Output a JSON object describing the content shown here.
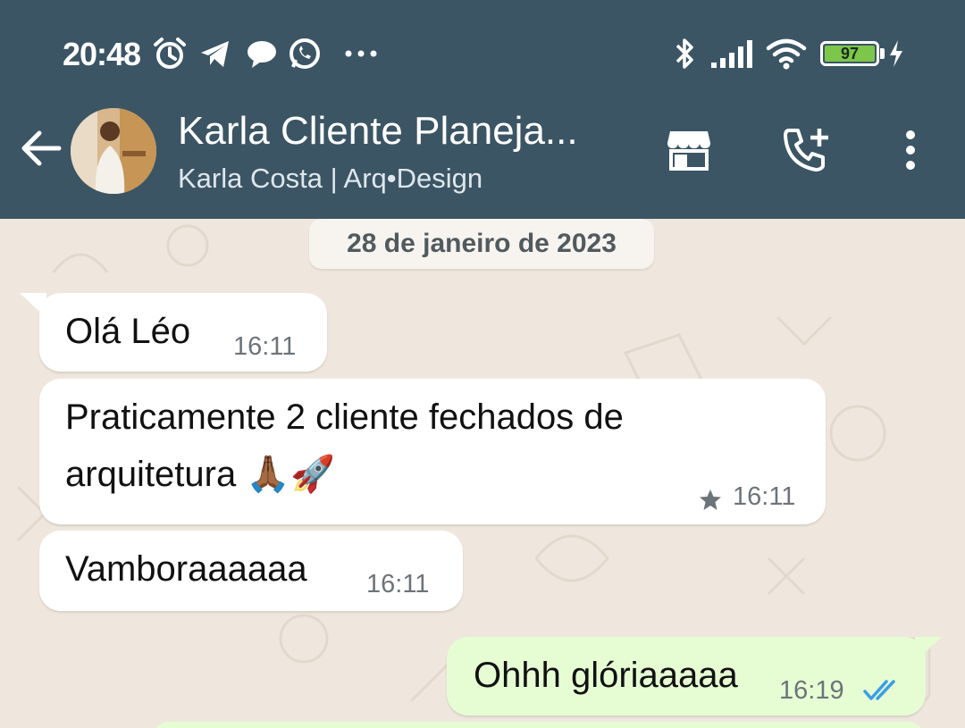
{
  "status_bar": {
    "time": "20:48",
    "battery_level": "97",
    "left_icons": [
      "alarm-icon",
      "telegram-icon",
      "chat-bubble-icon",
      "whatsapp-icon",
      "more-dots-icon"
    ],
    "right_icons": [
      "bluetooth-icon",
      "signal-icon",
      "wifi-icon",
      "battery-icon",
      "charging-icon"
    ]
  },
  "header": {
    "title": "Karla Cliente Planeja...",
    "subtitle": "Karla Costa | Arq•Design",
    "actions": [
      "store-icon",
      "add-call-icon",
      "overflow-menu-icon"
    ],
    "bar_color": "#3b5564"
  },
  "conversation": {
    "date_label": "28 de janeiro de 2023",
    "messages": [
      {
        "direction": "incoming",
        "text": "Olá Léo",
        "time": "16:11"
      },
      {
        "direction": "incoming",
        "text_line1": "Praticamente 2 cliente fechados de",
        "text_line2": "arquitetura",
        "emoji": "🙏🏾🚀",
        "time": "16:11",
        "starred": true
      },
      {
        "direction": "incoming",
        "text": "Vamboraaaaaa",
        "time": "16:11"
      },
      {
        "direction": "outgoing",
        "text": "Ohhh glóriaaaaa",
        "time": "16:19",
        "status": "read"
      }
    ],
    "incoming_color": "#ffffff",
    "outgoing_color": "#e6fdd4",
    "read_tick_color": "#3b9ee6"
  }
}
